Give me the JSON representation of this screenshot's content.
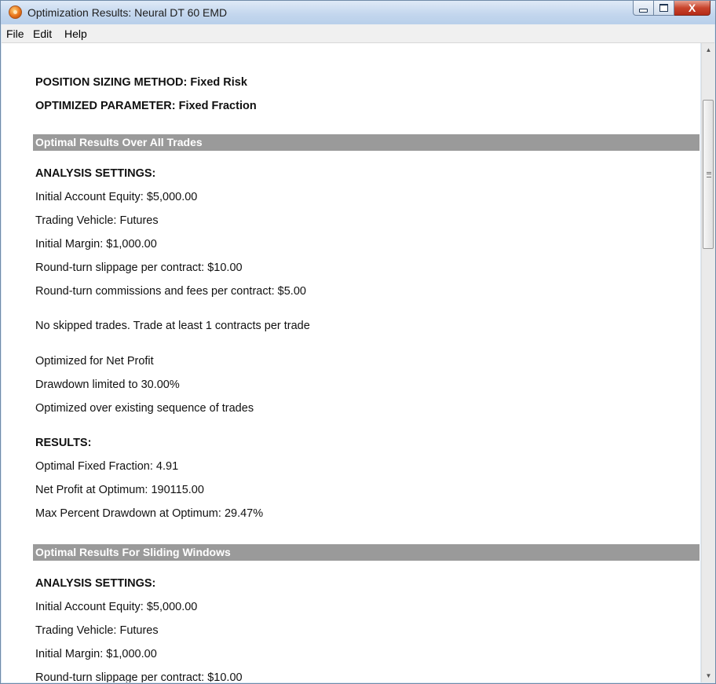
{
  "window": {
    "title": "Optimization Results: Neural DT 60 EMD",
    "app_icon": "app-logo-icon",
    "controls": {
      "minimize": "minimize-icon",
      "maximize": "maximize-icon",
      "close_label": "X"
    }
  },
  "menu": [
    "File",
    "Edit",
    "Help"
  ],
  "header": {
    "position_sizing": "POSITION SIZING METHOD:  Fixed Risk",
    "optimized_parameter": "OPTIMIZED PARAMETER:  Fixed Fraction"
  },
  "section1": {
    "heading": "Optimal Results Over All Trades",
    "analysis_heading": "ANALYSIS SETTINGS:",
    "initial_equity": "Initial Account Equity: $5,000.00",
    "trading_vehicle": "Trading Vehicle:  Futures",
    "initial_margin": "Initial Margin: $1,000.00",
    "slippage": "Round-turn slippage per contract: $10.00",
    "commissions": "Round-turn commissions and fees per contract: $5.00",
    "skipped": "No skipped trades. Trade at least 1 contracts per trade",
    "optimized_for": "Optimized for Net Profit",
    "drawdown_limit": "Drawdown limited to 30.00%",
    "sequence": "Optimized over existing sequence of trades",
    "results_heading": "RESULTS:",
    "optimal_fraction": "Optimal Fixed Fraction: 4.91",
    "net_profit": "Net Profit at Optimum: 190115.00",
    "max_drawdown": "Max Percent Drawdown at Optimum: 29.47%"
  },
  "section2": {
    "heading": "Optimal Results For Sliding Windows",
    "analysis_heading": "ANALYSIS SETTINGS:",
    "initial_equity": "Initial Account Equity: $5,000.00",
    "trading_vehicle": "Trading Vehicle:  Futures",
    "initial_margin": "Initial Margin: $1,000.00",
    "slippage_partial": "Round-turn slippage per contract: $10.00"
  },
  "scrollbar": {
    "up": "scroll-up-arrow-icon",
    "down": "scroll-down-arrow-icon",
    "position": 0.1
  }
}
